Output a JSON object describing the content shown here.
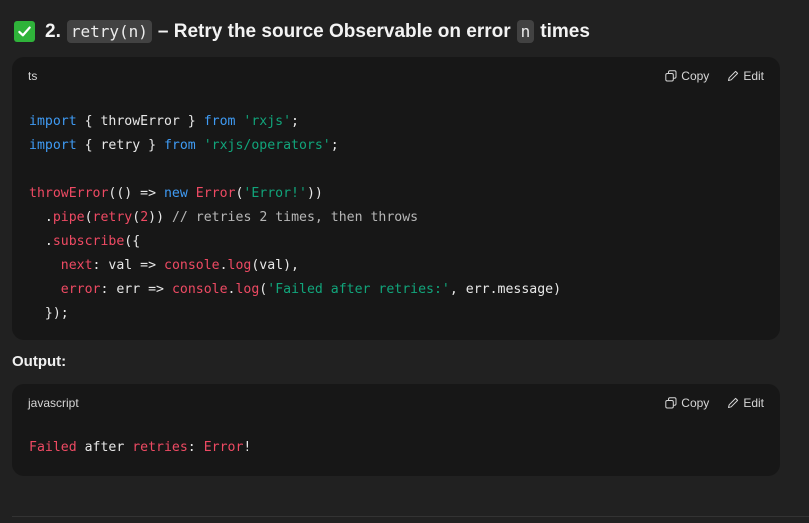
{
  "heading": {
    "number": "2.",
    "code_name": "retry(n)",
    "dash_text": "– Retry the source Observable on error",
    "code_n": "n",
    "tail": "times"
  },
  "codeblock1": {
    "language": "ts",
    "copy_label": "Copy",
    "edit_label": "Edit",
    "lines": [
      [
        {
          "t": "import",
          "c": "kw"
        },
        {
          "t": " { throwError } "
        },
        {
          "t": "from",
          "c": "kw"
        },
        {
          "t": " "
        },
        {
          "t": "'rxjs'",
          "c": "str"
        },
        {
          "t": ";"
        }
      ],
      [
        {
          "t": "import",
          "c": "kw"
        },
        {
          "t": " { retry } "
        },
        {
          "t": "from",
          "c": "kw"
        },
        {
          "t": " "
        },
        {
          "t": "'rxjs/operators'",
          "c": "str"
        },
        {
          "t": ";"
        }
      ],
      [],
      [
        {
          "t": "throwError",
          "c": "fn"
        },
        {
          "t": "(() => "
        },
        {
          "t": "new",
          "c": "kw"
        },
        {
          "t": " "
        },
        {
          "t": "Error",
          "c": "fn"
        },
        {
          "t": "("
        },
        {
          "t": "'Error!'",
          "c": "str"
        },
        {
          "t": "))"
        }
      ],
      [
        {
          "t": "  ."
        },
        {
          "t": "pipe",
          "c": "fn"
        },
        {
          "t": "("
        },
        {
          "t": "retry",
          "c": "fn"
        },
        {
          "t": "("
        },
        {
          "t": "2",
          "c": "fn"
        },
        {
          "t": ")) "
        },
        {
          "t": "// retries 2 times, then throws",
          "c": "cm"
        }
      ],
      [
        {
          "t": "  ."
        },
        {
          "t": "subscribe",
          "c": "fn"
        },
        {
          "t": "({"
        }
      ],
      [
        {
          "t": "    "
        },
        {
          "t": "next",
          "c": "fn"
        },
        {
          "t": ": val => "
        },
        {
          "t": "console",
          "c": "fn"
        },
        {
          "t": "."
        },
        {
          "t": "log",
          "c": "fn"
        },
        {
          "t": "(val),"
        }
      ],
      [
        {
          "t": "    "
        },
        {
          "t": "error",
          "c": "fn"
        },
        {
          "t": ": err => "
        },
        {
          "t": "console",
          "c": "fn"
        },
        {
          "t": "."
        },
        {
          "t": "log",
          "c": "fn"
        },
        {
          "t": "("
        },
        {
          "t": "'Failed after retries:'",
          "c": "str"
        },
        {
          "t": ", err.message)"
        }
      ],
      [
        {
          "t": "  });"
        }
      ]
    ]
  },
  "output_label": "Output:",
  "codeblock2": {
    "language": "javascript",
    "copy_label": "Copy",
    "edit_label": "Edit",
    "lines": [
      [
        {
          "t": "Failed",
          "c": "fn"
        },
        {
          "t": " after "
        },
        {
          "t": "retries",
          "c": "fn"
        },
        {
          "t": ": "
        },
        {
          "t": "Error",
          "c": "fn"
        },
        {
          "t": "!"
        }
      ]
    ]
  },
  "colors": {
    "keyword": "#3f9bf4",
    "string": "#11a57b",
    "function": "#ee4a63",
    "comment": "#b7b7b7",
    "check": "#2fb33a"
  },
  "icons": {
    "heading_check": "check-mark-icon",
    "copy": "copy-icon",
    "edit": "pencil-icon"
  }
}
